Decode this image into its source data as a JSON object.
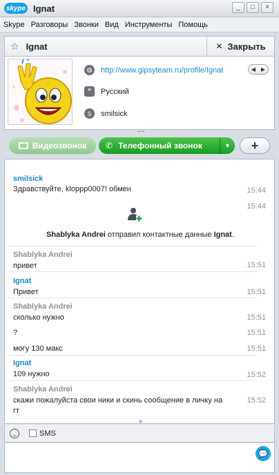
{
  "window": {
    "app_logo": "skype",
    "title": "Ignat"
  },
  "menu": [
    "Skype",
    "Разговоры",
    "Звонки",
    "Вид",
    "Инструменты",
    "Помощь"
  ],
  "contact": {
    "name": "Ignat",
    "close_label": "Закрыть"
  },
  "profile": {
    "website": "http://www.gipsyteam.ru/profile/Ignat",
    "language": "Русский",
    "skype_name": "smilsick"
  },
  "calls": {
    "video_label": "Видеозвонок",
    "phone_label": "Телефонный звонок",
    "add_label": "+"
  },
  "chat": {
    "first": {
      "sender": "smilsick",
      "text": "Здравствуйте, klоррр0007! обмен",
      "time": "15:44"
    },
    "contact_time": "15:44",
    "contacts_note": {
      "sender": "Shablyka Andrei",
      "middle": " отправил контактные данные ",
      "target": "Ignat",
      "end": "."
    },
    "messages": [
      {
        "sender": "Shablyka Andrei",
        "text": "привет",
        "time": "15:51"
      },
      {
        "sender": "Ignat",
        "text": "Привет",
        "time": "15:51"
      },
      {
        "sender": "Shablyka Andrei",
        "text": "сколько нужно",
        "time": "15:51"
      },
      {
        "sender": "",
        "text": "?",
        "time": "15:51"
      },
      {
        "sender": "",
        "text": "могу 130 макс",
        "time": "15:51"
      },
      {
        "sender": "Ignat",
        "text": "109 нужно",
        "time": "15:52"
      },
      {
        "sender": "Shablyka Andrei",
        "text": "скажи пожалуйста свои ники и скинь сообщение в личку на",
        "text2": "гт",
        "time": "15:52"
      }
    ]
  },
  "composer": {
    "sms_label": "SMS"
  },
  "colors": {
    "link": "#1c86c9",
    "call_green": "#179c22",
    "brand": "#1a9fe0"
  }
}
